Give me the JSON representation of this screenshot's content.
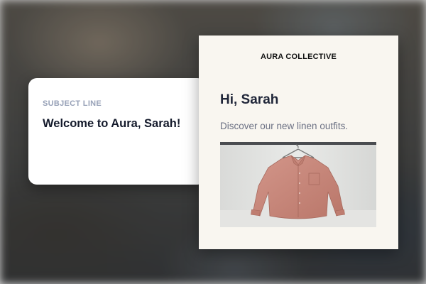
{
  "subject": {
    "label": "SUBJECT LINE",
    "text": "Welcome to Aura, Sarah!"
  },
  "email": {
    "brand": "AURA COLLECTIVE",
    "greeting": "Hi, Sarah",
    "body": "Discover our new linen outfits.",
    "image": "pink-linen-shirt-on-hanger"
  },
  "colors": {
    "subject_label": "#98a2b8",
    "subject_text": "#141a2b",
    "email_background": "#f9f6f0",
    "greeting": "#1f2538",
    "body_text": "#6b7083",
    "shirt": "#c9897d"
  }
}
